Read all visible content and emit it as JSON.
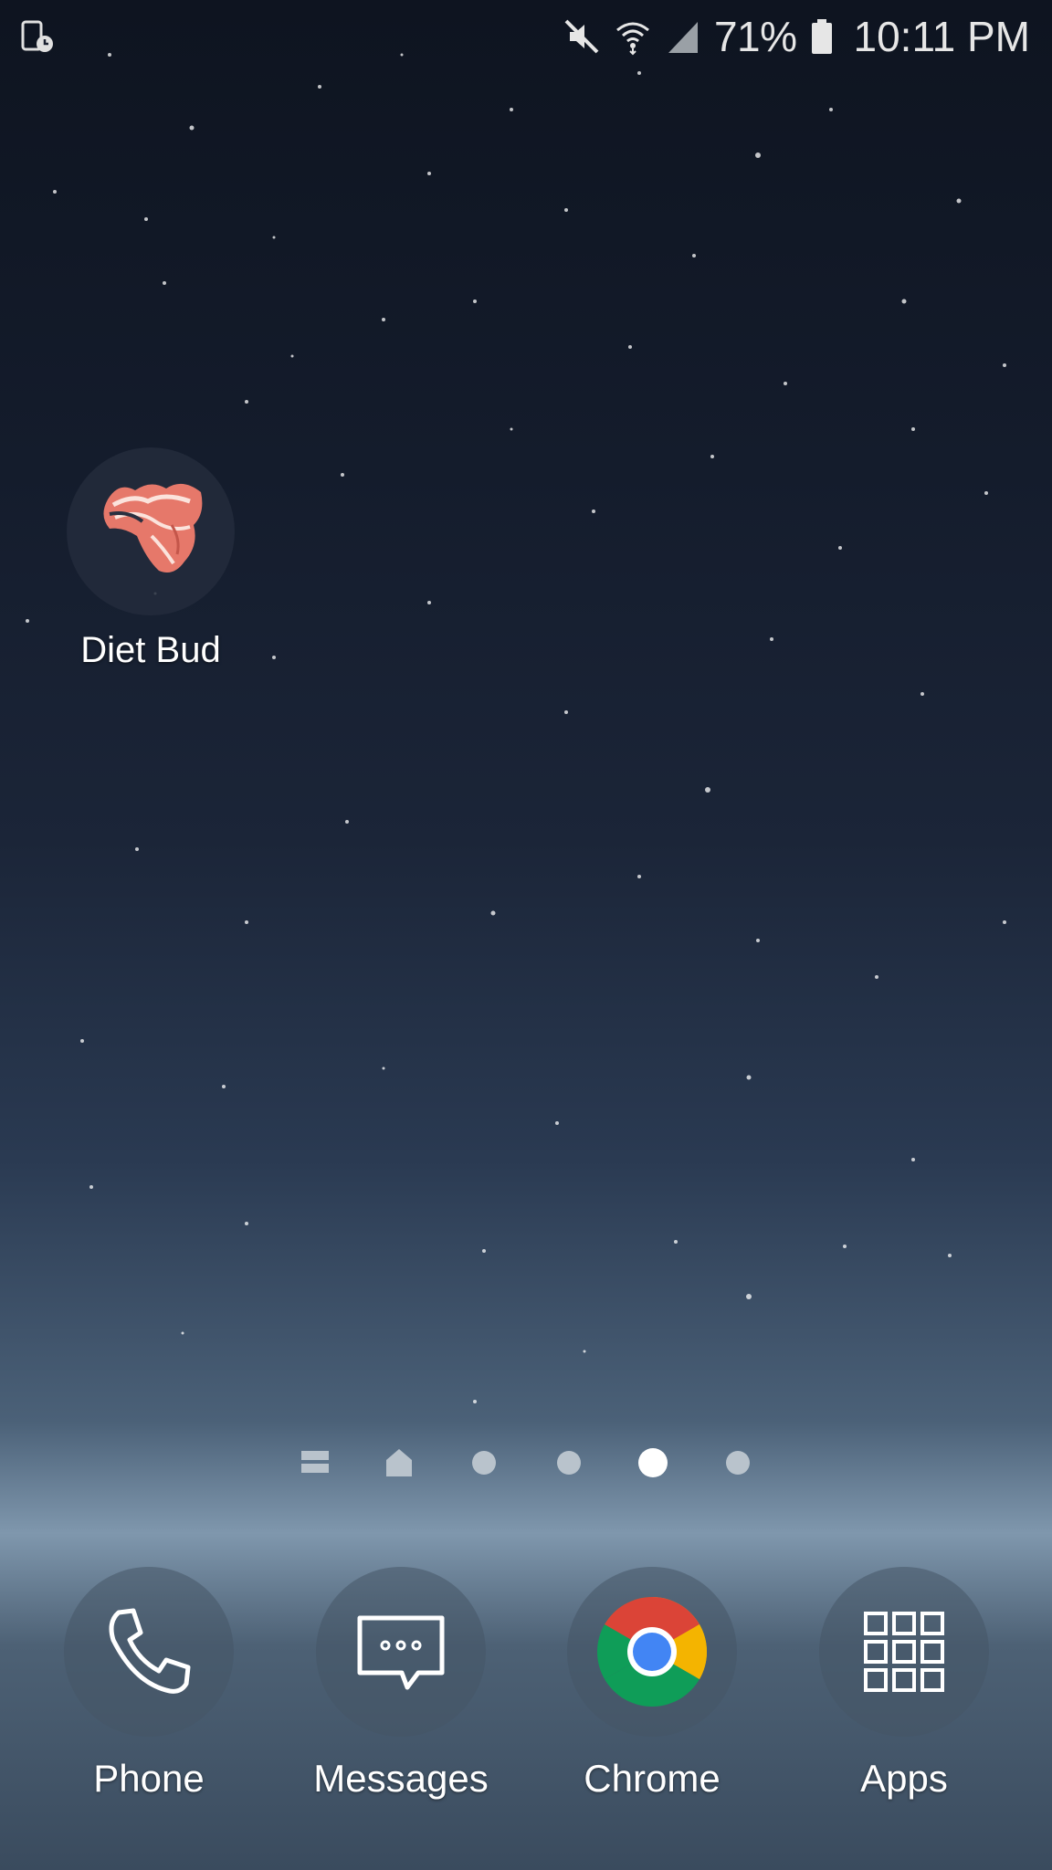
{
  "status_bar": {
    "left_icon": "screen-timer-icon",
    "icons": [
      "mute-icon",
      "wifi-icon",
      "signal-icon"
    ],
    "battery_percent": "71%",
    "battery_icon": "battery-icon",
    "time": "10:11 PM"
  },
  "home_apps": [
    {
      "label": "Diet Bud",
      "icon": "bacon-icon"
    }
  ],
  "page_indicator": {
    "items": [
      "menu-icon",
      "home-icon",
      "dot",
      "dot",
      "dot-active",
      "dot"
    ],
    "active_index": 4
  },
  "dock": {
    "items": [
      {
        "label": "Phone",
        "icon": "phone-icon"
      },
      {
        "label": "Messages",
        "icon": "messages-icon"
      },
      {
        "label": "Chrome",
        "icon": "chrome-icon"
      },
      {
        "label": "Apps",
        "icon": "apps-grid-icon"
      }
    ]
  },
  "colors": {
    "chrome_red": "#db4437",
    "chrome_green": "#0f9d58",
    "chrome_yellow": "#f4b400",
    "chrome_blue": "#4285f4",
    "bacon": "#e6786a"
  }
}
